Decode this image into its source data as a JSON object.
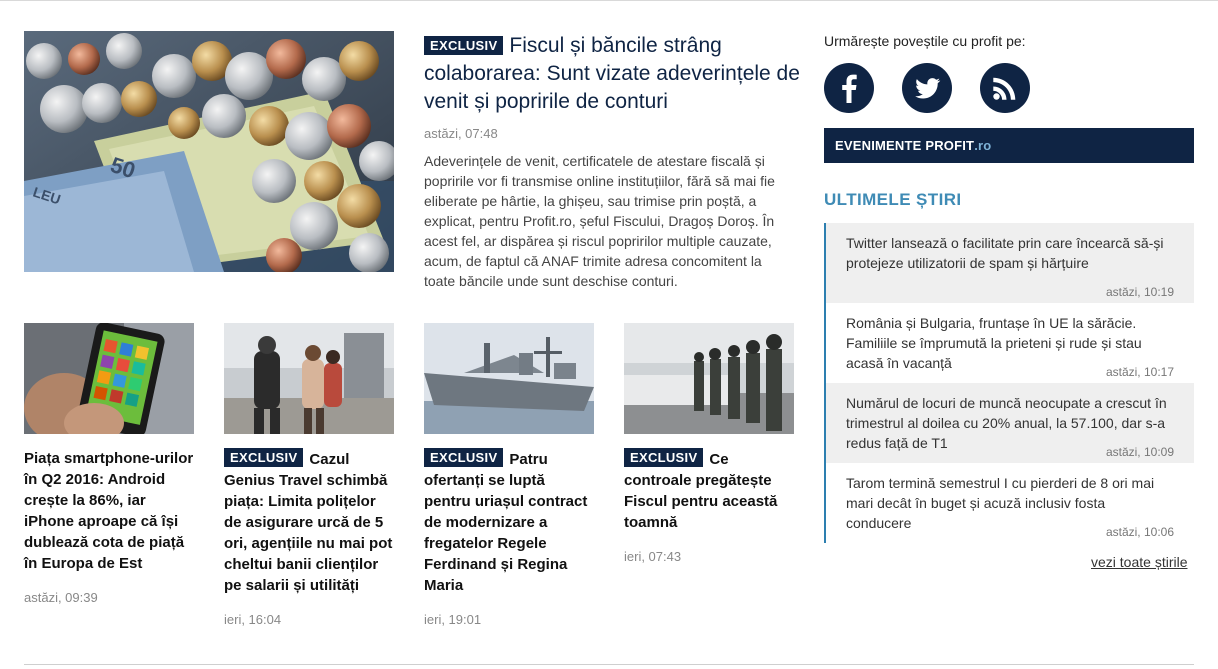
{
  "lead": {
    "badge": "EXCLUSIV",
    "title": "Fiscul și băncile strâng colaborarea: Sunt vizate adeverințele de venit și popririle de conturi",
    "time": "astăzi, 07:48",
    "summary": "Adeverințele de venit, certificatele de atestare fiscală și popririle vor fi transmise online instituțiilor, fără să mai fie eliberate pe hârtie, la ghișeu, sau trimise prin poștă, a explicat, pentru Profit.ro, șeful Fiscului, Dragoș Doroș. În acest fel, ar dispărea și riscul popririlor multiple cauzate, acum, de faptul că ANAF trimite adresa concomitent la toate băncile unde sunt deschise conturi."
  },
  "cards": [
    {
      "badge": "",
      "title": "Piața smartphone-urilor în Q2 2016: Android crește la 86%, iar iPhone aproape că își dublează cota de piață în Europa de Est",
      "time": "astăzi, 09:39"
    },
    {
      "badge": "EXCLUSIV",
      "title": "Cazul Genius Travel schimbă piața: Limita polițelor de asigurare urcă de 5 ori, agențiile nu mai pot cheltui banii clienților pe salarii și utilități",
      "time": "ieri, 16:04"
    },
    {
      "badge": "EXCLUSIV",
      "title": "Patru ofertanți se luptă pentru uriașul contract de modernizare a fregatelor Regele Ferdinand și Regina Maria",
      "time": "ieri, 19:01"
    },
    {
      "badge": "EXCLUSIV",
      "title": "Ce controale pregătește Fiscul pentru această toamnă",
      "time": "ieri, 07:43"
    }
  ],
  "sidebar": {
    "follow_label": "Urmărește poveștile cu profit pe:",
    "social": [
      "facebook-icon",
      "twitter-icon",
      "rss-icon"
    ],
    "events_main": "EVENIMENTE PROFIT",
    "events_suffix": ".ro",
    "latest_heading": "ULTIMELE ȘTIRI",
    "news": [
      {
        "text": "Twitter lansează o facilitate prin care încearcă să-și protejeze utilizatorii de spam și hărțuire",
        "time": "astăzi, 10:19"
      },
      {
        "text": "România și Bulgaria, fruntașe în UE la sărăcie. Familiile se împrumută la prieteni și rude și stau acasă în vacanță",
        "time": "astăzi, 10:17"
      },
      {
        "text": "Numărul de locuri de muncă neocupate a crescut în trimestrul al doilea cu 20% anual, la 57.100, dar s-a redus față de T1",
        "time": "astăzi, 10:09"
      },
      {
        "text": "Tarom termină semestrul I cu pierderi de 8 ori mai mari decât în buget și acuză inclusiv fosta conducere",
        "time": "astăzi, 10:06"
      }
    ],
    "see_all": "vezi toate știrile"
  },
  "colors": {
    "navy": "#0f2444",
    "heading_blue": "#3f8bb5",
    "list_border": "#2d7fb0"
  }
}
